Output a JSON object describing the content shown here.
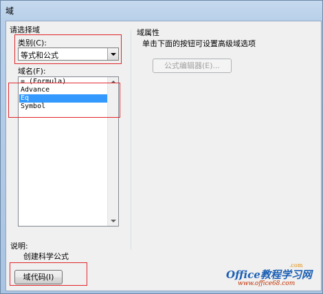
{
  "window": {
    "title": "域"
  },
  "left_panel": {
    "group_label": "请选择域",
    "category_label": "类别(C):",
    "category_value": "等式和公式",
    "fieldname_label": "域名(F):",
    "fields": [
      "= (Formula)",
      "Advance",
      "Eq",
      "Symbol"
    ],
    "selected_field": "Eq"
  },
  "right_panel": {
    "group_label": "域属性",
    "hint": "单击下面的按钮可设置高级域选项",
    "formula_editor_button": "公式编辑器(E)..."
  },
  "description": {
    "label": "说明:",
    "text": "创建科学公式"
  },
  "field_codes_button": "域代码(I)",
  "watermark": {
    "brand": "Office教程学习网",
    "url": "www.office68.com",
    "com": ".com"
  }
}
